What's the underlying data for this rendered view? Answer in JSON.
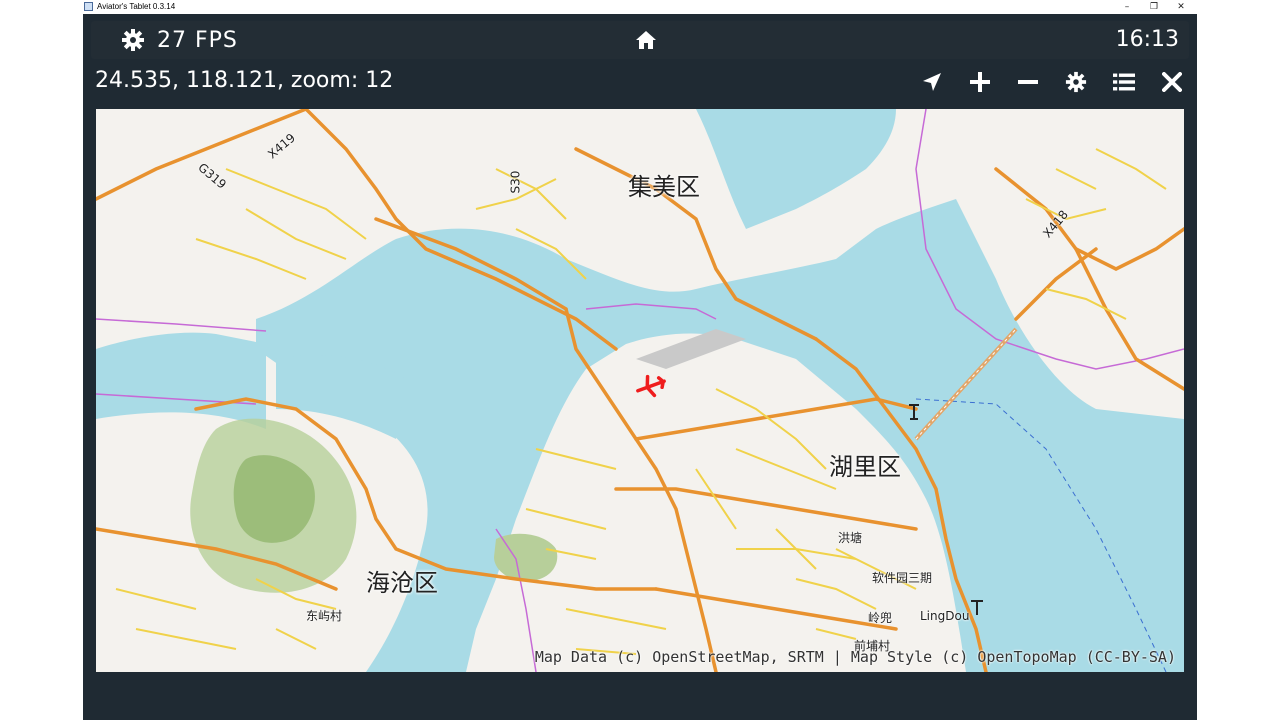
{
  "window": {
    "title": "Aviator's Tablet  0.3.14",
    "min": "–",
    "max": "❐",
    "close": "✕"
  },
  "topbar": {
    "fps": "27 FPS",
    "clock": "16:13",
    "settings_icon": "gear-icon",
    "home_icon": "home-icon"
  },
  "status": {
    "coords": "24.535, 118.121, zoom: 12"
  },
  "toolbar": [
    "locate-arrow-icon",
    "zoom-in-icon",
    "zoom-out-icon",
    "settings-gear-icon",
    "layers-list-icon",
    "close-icon"
  ],
  "map": {
    "districts": {
      "jimei": "集美区",
      "huli": "湖里区",
      "haicang": "海沧区"
    },
    "places": {
      "hongtang": "洪塘",
      "software_park": "软件园三期",
      "lingdou": "LingDou",
      "lingdou_cn": "岭兜",
      "dongyu": "东屿村",
      "qianpu": "前埔村"
    },
    "roads": {
      "x419": "X419",
      "g319": "G319",
      "s30": "S30",
      "x418": "X418"
    },
    "attribution": "Map Data (c) OpenStreetMap, SRTM | Map Style (c) OpenTopoMap (CC-BY-SA)"
  }
}
